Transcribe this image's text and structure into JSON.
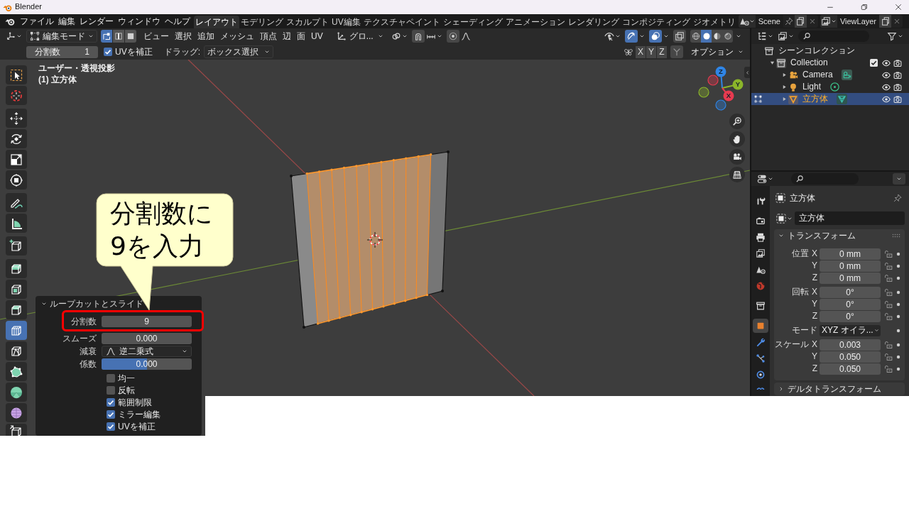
{
  "window": {
    "title": "Blender"
  },
  "topbar": {
    "menus": [
      "ファイル",
      "編集",
      "レンダー",
      "ウィンドウ",
      "ヘルプ"
    ],
    "workspaces": [
      {
        "label": "レイアウト",
        "selected": true
      },
      {
        "label": "モデリング",
        "selected": false
      },
      {
        "label": "スカルプト",
        "selected": false
      },
      {
        "label": "UV編集",
        "selected": false
      },
      {
        "label": "テクスチャペイント",
        "selected": false
      },
      {
        "label": "シェーディング",
        "selected": false
      },
      {
        "label": "アニメーション",
        "selected": false
      },
      {
        "label": "レンダリング",
        "selected": false
      },
      {
        "label": "コンポジティング",
        "selected": false
      },
      {
        "label": "ジオメトリ",
        "selected": false
      }
    ],
    "scene": "Scene",
    "view_layer": "ViewLayer"
  },
  "viewport_header": {
    "mode": "編集モード",
    "select_modes": [
      {
        "kind": "vertex",
        "selected": true
      },
      {
        "kind": "edge",
        "selected": false
      },
      {
        "kind": "face",
        "selected": false
      }
    ],
    "menus": [
      "ビュー",
      "選択",
      "追加",
      "メッシュ",
      "頂点",
      "辺",
      "面",
      "UV"
    ],
    "orientation": "グロ...",
    "snap_toggles": [
      {
        "kind": "snap",
        "on": false
      },
      {
        "kind": "proportional",
        "on": false
      }
    ],
    "display_toggles": [
      {
        "kind": "gizmo",
        "on": true
      },
      {
        "kind": "overlay",
        "on": true
      },
      {
        "kind": "xray",
        "on": false
      }
    ],
    "shading_modes": [
      {
        "kind": "wireframe",
        "selected": false
      },
      {
        "kind": "solid",
        "selected": true
      },
      {
        "kind": "material",
        "selected": false
      },
      {
        "kind": "rendered",
        "selected": false
      }
    ]
  },
  "tool_settings": {
    "cuts": {
      "label": "分割数",
      "value": "1"
    },
    "correct_uv": {
      "label": "UVを補正",
      "checked": true
    },
    "drag": {
      "label": "ドラッグ:",
      "value": "ボックス選択"
    },
    "mirror_axes": [
      {
        "label": "X",
        "on": false
      },
      {
        "label": "Y",
        "on": false
      },
      {
        "label": "Z",
        "on": false
      }
    ],
    "options": "オプション"
  },
  "toolbar": [
    {
      "kind": "select",
      "selected": false
    },
    {
      "kind": "cursor",
      "selected": false
    },
    {
      "kind": "move",
      "selected": false
    },
    {
      "kind": "rotate",
      "selected": false
    },
    {
      "kind": "scale",
      "selected": false
    },
    {
      "kind": "transform",
      "selected": false
    },
    {
      "kind": "annotate",
      "selected": false
    },
    {
      "kind": "measure",
      "selected": false
    },
    {
      "kind": "add_cube",
      "selected": false
    },
    {
      "kind": "extrude",
      "selected": false
    },
    {
      "kind": "inset",
      "selected": false
    },
    {
      "kind": "bevel",
      "selected": false
    },
    {
      "kind": "loop_cut",
      "selected": true
    },
    {
      "kind": "knife",
      "selected": false
    },
    {
      "kind": "poly_build",
      "selected": false
    },
    {
      "kind": "spin",
      "selected": false
    },
    {
      "kind": "smooth",
      "selected": false
    },
    {
      "kind": "shear",
      "selected": false
    }
  ],
  "viewport": {
    "view_name": "ユーザー・透視投影",
    "object_label": "(1) 立方体",
    "gizmo": [
      {
        "label": "Z",
        "color": "#2f85e6"
      },
      {
        "label": "Y",
        "color": "#8bb52a"
      },
      {
        "label": "X",
        "color": "#e83a50"
      }
    ]
  },
  "operator_panel": {
    "title": "ループカットとスライド",
    "expanded": true,
    "fields": [
      {
        "kind": "number",
        "label": "分割数",
        "value": "9"
      },
      {
        "kind": "number",
        "label": "スムーズ",
        "value": "0.000"
      },
      {
        "kind": "dropdown",
        "label": "減衰",
        "value": "逆二乗式"
      },
      {
        "kind": "slider",
        "label": "係数",
        "value": "0.000",
        "level": 0.5
      }
    ],
    "options": [
      {
        "label": "均一",
        "checked": false
      },
      {
        "label": "反転",
        "checked": false
      },
      {
        "label": "範囲制限",
        "checked": true
      },
      {
        "label": "ミラー編集",
        "checked": true
      },
      {
        "label": "UVを補正",
        "checked": true
      }
    ]
  },
  "callout": {
    "lines": [
      "分割数に",
      "9を入力"
    ]
  },
  "outliner": {
    "tree": [
      {
        "label": "シーンコレクション",
        "kind": "scene_collection",
        "selected": false,
        "children": [
          {
            "label": "Collection",
            "kind": "collection",
            "expanded": true,
            "checked": true,
            "selected": false,
            "children": [
              {
                "label": "Camera",
                "kind": "camera",
                "expanded": false,
                "edit_mode": false,
                "selected": false
              },
              {
                "label": "Light",
                "kind": "light",
                "expanded": false,
                "edit_mode": false,
                "selected": false
              },
              {
                "label": "立方体",
                "kind": "mesh",
                "expanded": false,
                "edit_mode": true,
                "selected": true
              }
            ]
          }
        ]
      }
    ]
  },
  "properties": {
    "tabs": [
      {
        "kind": "tool",
        "selected": false
      },
      {
        "kind": "render",
        "selected": false
      },
      {
        "kind": "output",
        "selected": false
      },
      {
        "kind": "view_layer",
        "selected": false
      },
      {
        "kind": "scene",
        "selected": false
      },
      {
        "kind": "world",
        "selected": false
      },
      {
        "kind": "collection",
        "selected": false
      },
      {
        "kind": "object",
        "selected": true
      },
      {
        "kind": "modifiers",
        "selected": false
      },
      {
        "kind": "particles",
        "selected": false
      },
      {
        "kind": "physics",
        "selected": false
      },
      {
        "kind": "constraints",
        "selected": false
      }
    ],
    "object_name": "立方体",
    "datablock": "立方体",
    "panels": [
      {
        "title": "トランスフォーム",
        "expanded": true,
        "rows": [
          {
            "kind": "vector",
            "label": "位置",
            "items": [
              {
                "axis": "X",
                "value": "0 mm"
              },
              {
                "axis": "Y",
                "value": "0 mm"
              },
              {
                "axis": "Z",
                "value": "0 mm"
              }
            ]
          },
          {
            "kind": "vector",
            "label": "回転",
            "items": [
              {
                "axis": "X",
                "value": "0°"
              },
              {
                "axis": "Y",
                "value": "0°"
              },
              {
                "axis": "Z",
                "value": "0°"
              }
            ]
          },
          {
            "kind": "enum",
            "label": "モード",
            "value": "XYZ オイラ..."
          },
          {
            "kind": "vector",
            "label": "スケール",
            "items": [
              {
                "axis": "X",
                "value": "0.003"
              },
              {
                "axis": "Y",
                "value": "0.050"
              },
              {
                "axis": "Z",
                "value": "0.050"
              }
            ]
          }
        ]
      },
      {
        "title": "デルタトランスフォーム",
        "expanded": false
      }
    ]
  }
}
